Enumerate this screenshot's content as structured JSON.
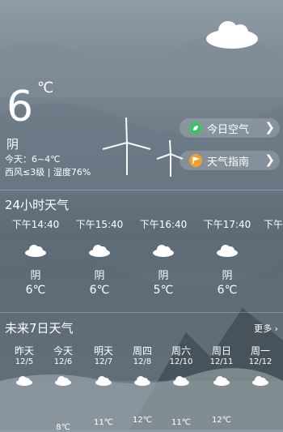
{
  "current": {
    "temperature": "6",
    "unit": "℃",
    "condition": "阴",
    "range": "今天：6~4℃",
    "wind_humidity": "西风≤3级 | 湿度76%"
  },
  "buttons": {
    "air_label": "今日空气",
    "guide_label": "天气指南"
  },
  "hourly": {
    "title": "24小时天气",
    "items": [
      {
        "time": "下午14:40",
        "cond": "阴",
        "temp": "6℃"
      },
      {
        "time": "下午15:40",
        "cond": "阴",
        "temp": "6℃"
      },
      {
        "time": "下午16:40",
        "cond": "阴",
        "temp": "5℃"
      },
      {
        "time": "下午17:40",
        "cond": "阴",
        "temp": "6℃"
      },
      {
        "time": "下午"
      }
    ]
  },
  "daily": {
    "title": "未来7日天气",
    "more": "更多",
    "items": [
      {
        "name": "昨天",
        "date": "12/5"
      },
      {
        "name": "今天",
        "date": "12/6",
        "high": "8℃"
      },
      {
        "name": "明天",
        "date": "12/7",
        "high": "11℃"
      },
      {
        "name": "周四",
        "date": "12/8",
        "high": "12℃"
      },
      {
        "name": "周六",
        "date": "12/10",
        "high": "11℃"
      },
      {
        "name": "周日",
        "date": "12/11",
        "high": "12℃"
      },
      {
        "name": "周一",
        "date": "12/12"
      }
    ]
  },
  "colors": {
    "air_icon": "#3fbf6a",
    "guide_icon": "#f0a030"
  },
  "icons": {
    "header": "cloud-icon",
    "hourly": "cloud-icon",
    "daily": "cloud-icon",
    "air": "leaf-icon",
    "guide": "flag-icon"
  }
}
